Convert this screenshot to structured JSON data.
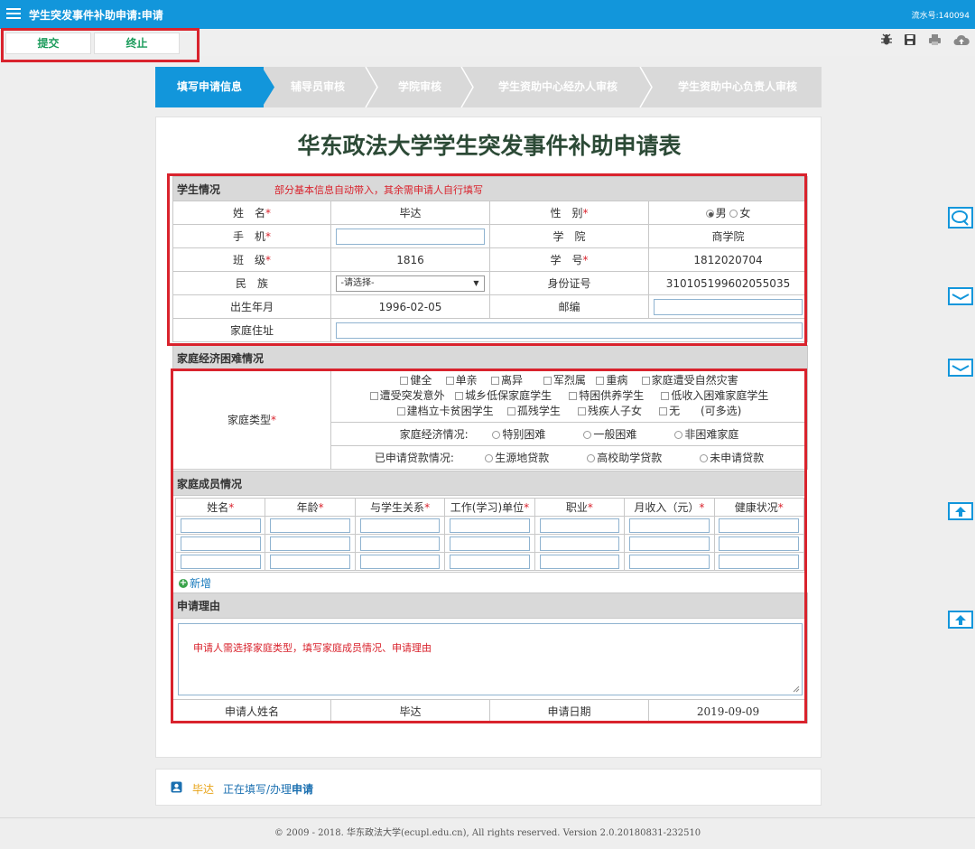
{
  "topbar": {
    "title": "学生突发事件补助申请:申请",
    "serial": "流水号:140094"
  },
  "toolbar": {
    "submit_label": "提交",
    "stop_label": "终止"
  },
  "steps": [
    "填写申请信息",
    "辅导员审核",
    "学院审核",
    "学生资助中心经办人审核",
    "学生资助中心负责人审核"
  ],
  "form": {
    "title": "华东政法大学学生突发事件补助申请表",
    "student_section": "学生情况",
    "student_note": "部分基本信息自动带入，其余需申请人自行填写",
    "name_label": "姓　名",
    "name_value": "毕达",
    "gender_label": "性　别",
    "gender_male": "男",
    "gender_female": "女",
    "phone_label": "手　机",
    "phone_value": "",
    "college_label": "学　院",
    "college_value": "商学院",
    "class_label": "班　级",
    "class_value": "1816",
    "student_no_label": "学　号",
    "student_no_value": "1812020704",
    "ethnic_label": "民　族",
    "ethnic_select": "-请选择-",
    "id_label": "身份证号",
    "id_value": "310105199602055035",
    "birth_label": "出生年月",
    "birth_value": "1996-02-05",
    "zip_label": "邮编",
    "zip_value": "",
    "address_label": "家庭住址",
    "address_value": "",
    "econ_section": "家庭经济困难情况",
    "family_type_label": "家庭类型",
    "family_types": [
      "健全",
      "单亲",
      "离异",
      "军烈属",
      "重病",
      "家庭遭受自然灾害",
      "遭受突发意外",
      "城乡低保家庭学生",
      "特困供养学生",
      "低收入困难家庭学生",
      "建档立卡贫困学生",
      "孤残学生",
      "残疾人子女",
      "无"
    ],
    "multi_note": "(可多选)",
    "econ_label": "家庭经济情况:",
    "econ_options": [
      "特别困难",
      "一般困难",
      "非困难家庭"
    ],
    "loan_label": "已申请贷款情况:",
    "loan_options": [
      "生源地贷款",
      "高校助学贷款",
      "未申请贷款"
    ],
    "members_section": "家庭成员情况",
    "member_headers": [
      "姓名",
      "年龄",
      "与学生关系",
      "工作(学习)单位",
      "职业",
      "月收入（元）",
      "健康状况"
    ],
    "add_label": "新增",
    "reason_section": "申请理由",
    "reason_text": "申请人需选择家庭类型，填写家庭成员情况、申请理由",
    "applicant_label": "申请人姓名",
    "applicant_value": "毕达",
    "date_label": "申请日期",
    "date_value": "2019-09-09"
  },
  "status": {
    "user": "毕达",
    "action_prefix": "正在填写/办理",
    "action_strong": "申请"
  },
  "footer": "© 2009 - 2018. 华东政法大学(ecupl.edu.cn), All rights reserved. Version 2.0.20180831-232510",
  "colors": {
    "primary": "#1296db",
    "highlight_red": "#d9232d",
    "section_gray": "#d9d9d9"
  }
}
